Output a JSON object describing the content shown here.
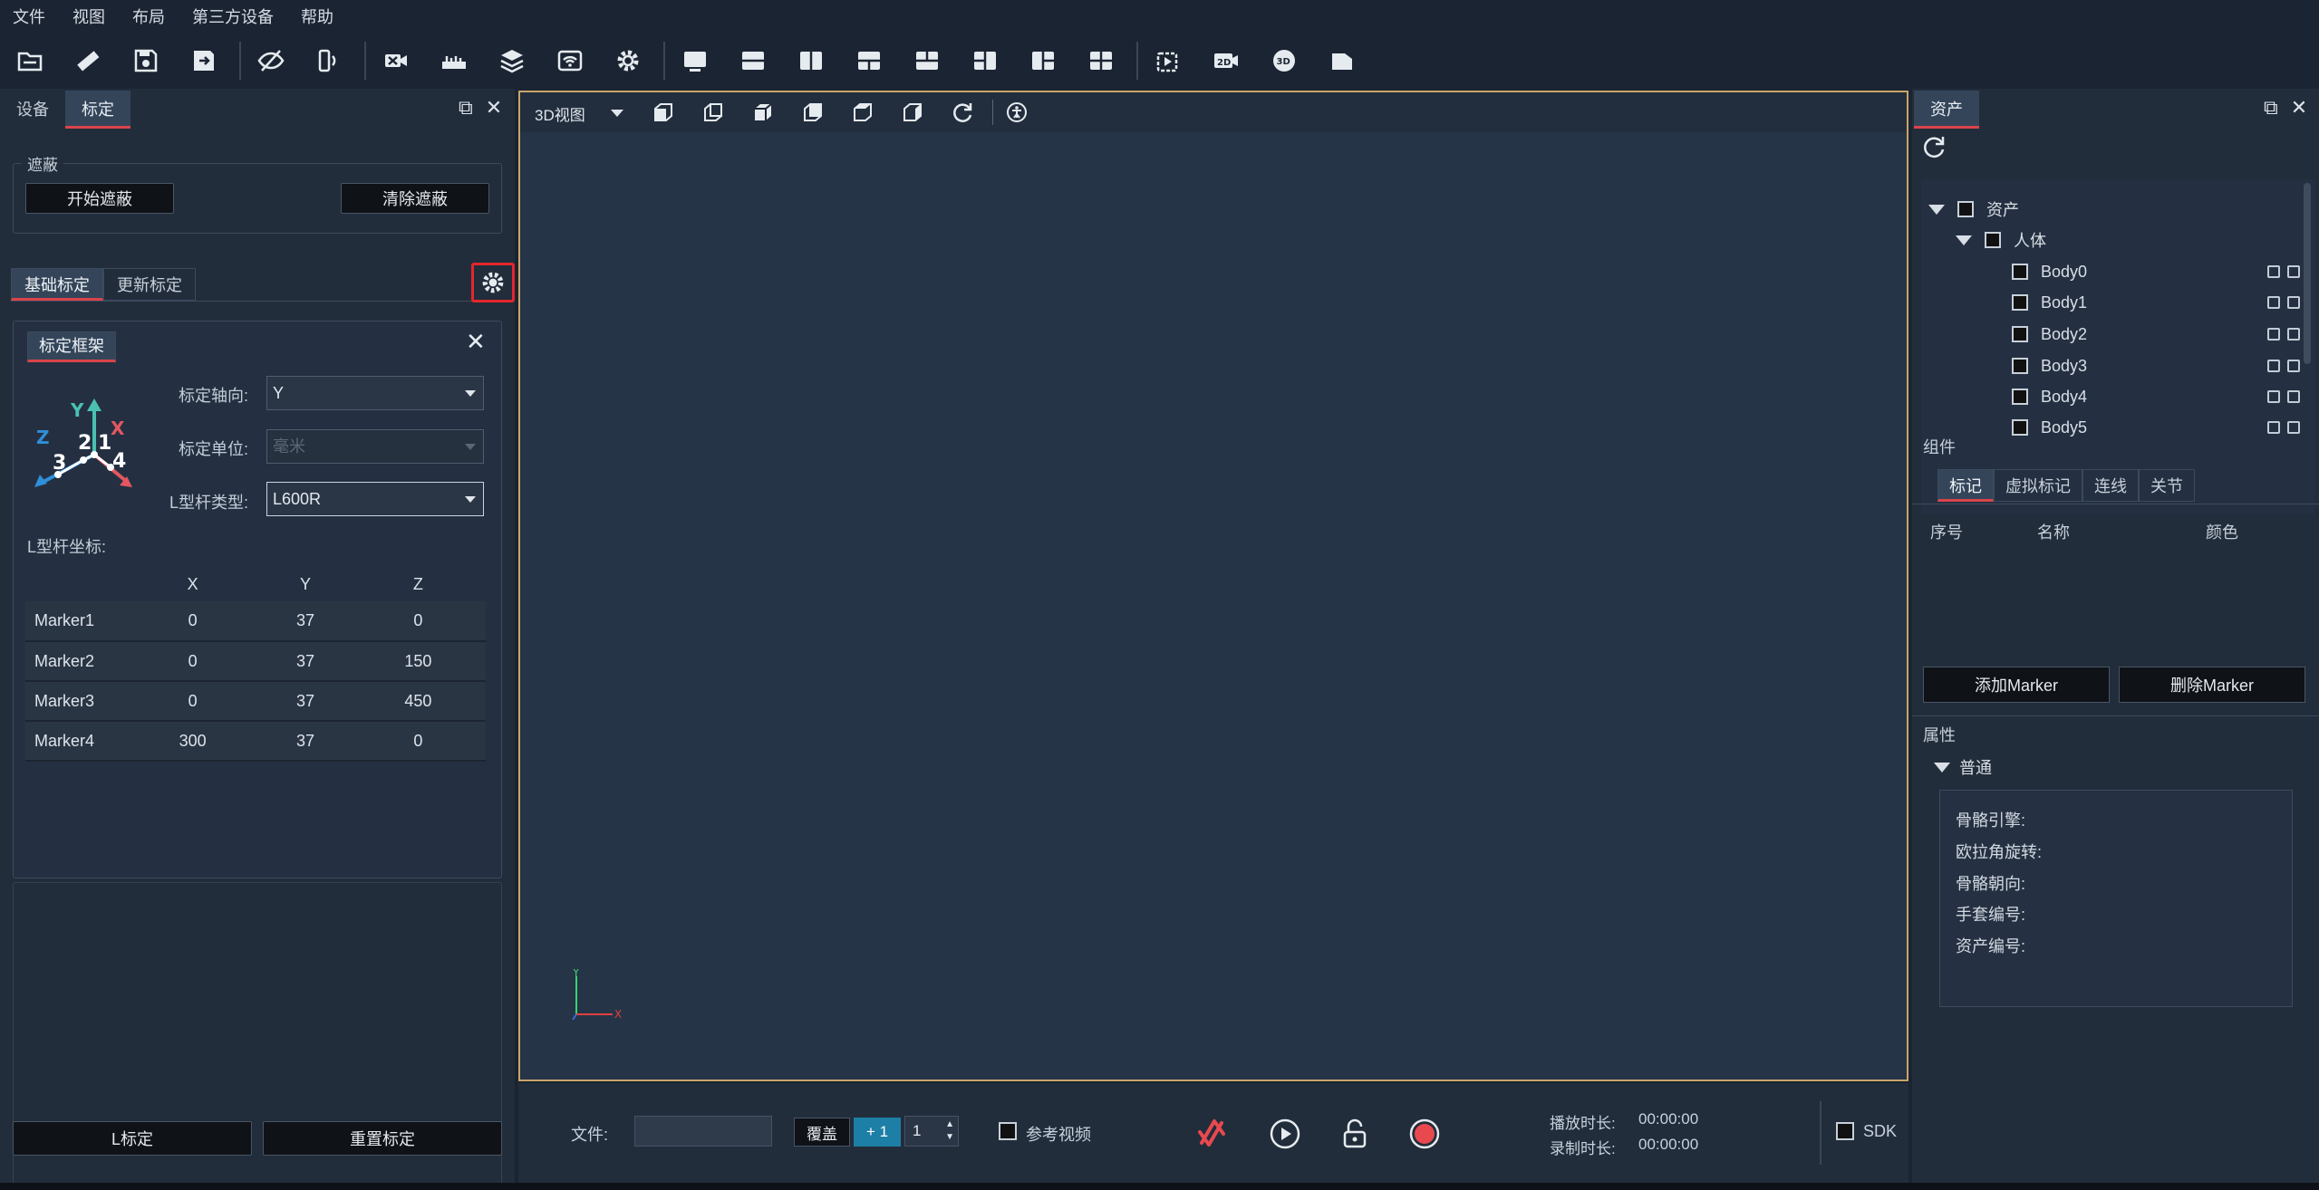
{
  "menu": [
    "文件",
    "视图",
    "布局",
    "第三方设备",
    "帮助"
  ],
  "toolbar_icons": [
    "open-folder-icon",
    "ruler-icon",
    "save-icon",
    "save-as-icon",
    "hide-icon",
    "device-sync-icon",
    "camera-off-icon",
    "calibration-bar-icon",
    "layers-icon",
    "wifi-router-icon",
    "settings-icon",
    "layout-single-icon",
    "layout-split-h-icon",
    "layout-split-v-icon",
    "layout-3a-icon",
    "layout-3b-icon",
    "layout-3c-icon",
    "layout-3d-icon",
    "layout-quad-icon",
    "camera-record-icon",
    "video-2d-icon",
    "view-3d-icon",
    "document-icon"
  ],
  "left": {
    "tabs": [
      "设备",
      "标定"
    ],
    "active_tab": "标定",
    "mask": {
      "title": "遮蔽",
      "start": "开始遮蔽",
      "clear": "清除遮蔽"
    },
    "subtabs": [
      "基础标定",
      "更新标定"
    ],
    "frame": {
      "title": "标定框架",
      "axis_label": "标定轴向:",
      "axis_value": "Y",
      "unit_label": "标定单位:",
      "unit_value": "毫米",
      "type_label": "L型杆类型:",
      "type_value": "L600R",
      "coords_label": "L型杆坐标:",
      "diagram_labels": {
        "y": "Y",
        "z": "Z",
        "x": "X",
        "n1": "1",
        "n2": "2",
        "n3": "3",
        "n4": "4"
      },
      "columns": [
        "X",
        "Y",
        "Z"
      ],
      "rows": [
        {
          "name": "Marker1",
          "x": "0",
          "y": "37",
          "z": "0"
        },
        {
          "name": "Marker2",
          "x": "0",
          "y": "37",
          "z": "150"
        },
        {
          "name": "Marker3",
          "x": "0",
          "y": "37",
          "z": "450"
        },
        {
          "name": "Marker4",
          "x": "300",
          "y": "37",
          "z": "0"
        }
      ]
    },
    "footer": {
      "l_calib": "L标定",
      "reset_calib": "重置标定"
    }
  },
  "viewport": {
    "view_mode": "3D视图",
    "axis_y": "Y",
    "axis_x": "X"
  },
  "bottom": {
    "file_label": "文件:",
    "overwrite": "覆盖",
    "plus_one": "+ 1",
    "spin_value": "1",
    "ref_video": "参考视频",
    "play_duration_label": "播放时长:",
    "play_duration": "00:00:00",
    "record_duration_label": "录制时长:",
    "record_duration": "00:00:00",
    "sdk": "SDK"
  },
  "right": {
    "tab": "资产",
    "tree": {
      "root": "资产",
      "group": "人体",
      "bodies": [
        "Body0",
        "Body1",
        "Body2",
        "Body3",
        "Body4",
        "Body5"
      ]
    },
    "components_label": "组件",
    "comp_tabs": [
      "标记",
      "虚拟标记",
      "连线",
      "关节"
    ],
    "columns": [
      "序号",
      "名称",
      "颜色"
    ],
    "add_marker": "添加Marker",
    "delete_marker": "删除Marker",
    "properties_label": "属性",
    "general": "普通",
    "props": [
      "骨骼引擎:",
      "欧拉角旋转:",
      "骨骼朝向:",
      "手套编号:",
      "资产编号:"
    ]
  },
  "colors": {
    "accent_red": "#d9444a",
    "viewport_border": "#c9a46c",
    "record_red": "#e8494f",
    "plus_btn": "#1d7fa5"
  }
}
